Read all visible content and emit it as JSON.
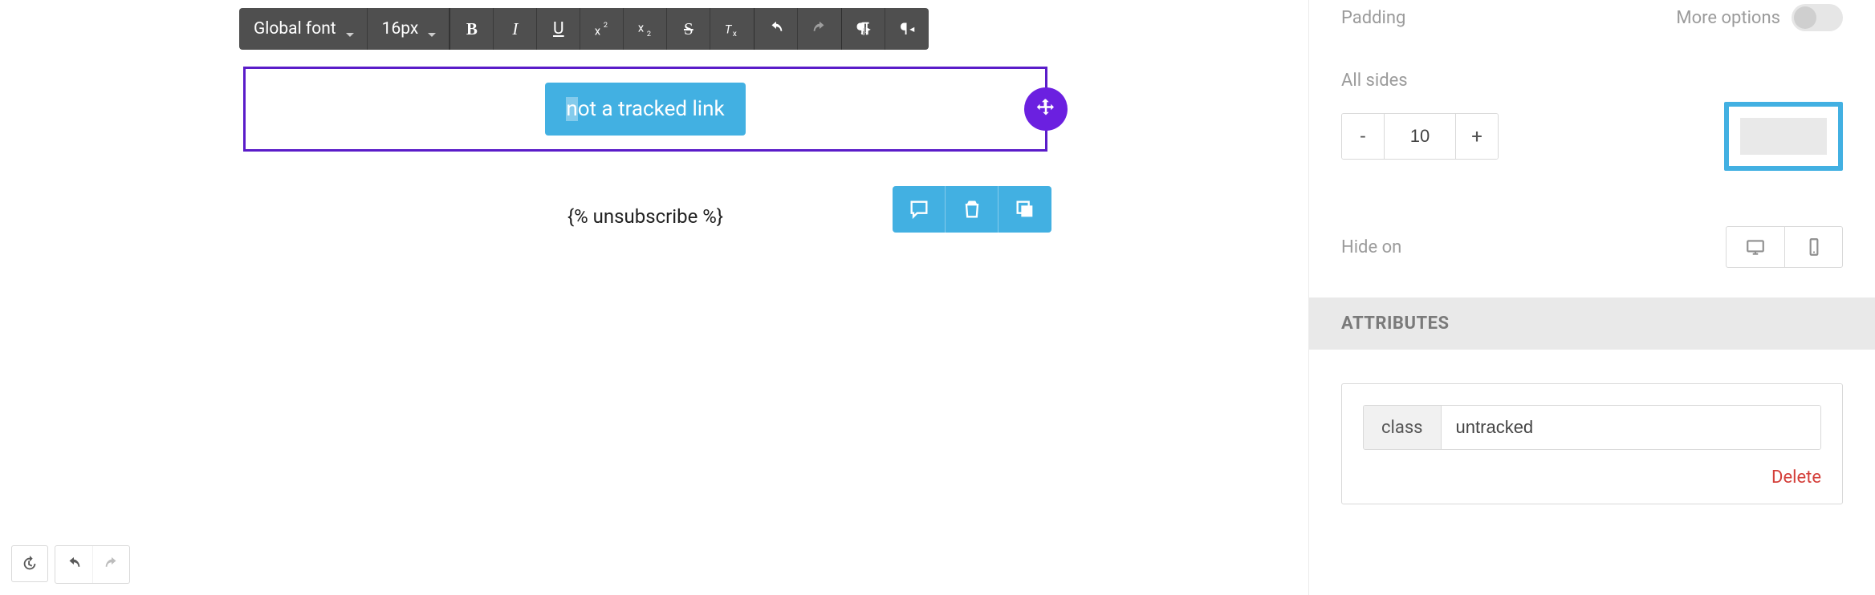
{
  "toolbar": {
    "font_family": "Global font",
    "font_size": "16px"
  },
  "canvas": {
    "button_text_prefix": "n",
    "button_text_rest": "ot a tracked link",
    "unsubscribe": "{% unsubscribe %}"
  },
  "sidebar": {
    "padding_label": "Padding",
    "more_options": "More options",
    "all_sides_label": "All sides",
    "all_sides_value": "10",
    "hide_on_label": "Hide on",
    "attributes_header": "ATTRIBUTES",
    "attr_key": "class",
    "attr_value": "untracked",
    "delete_label": "Delete"
  }
}
